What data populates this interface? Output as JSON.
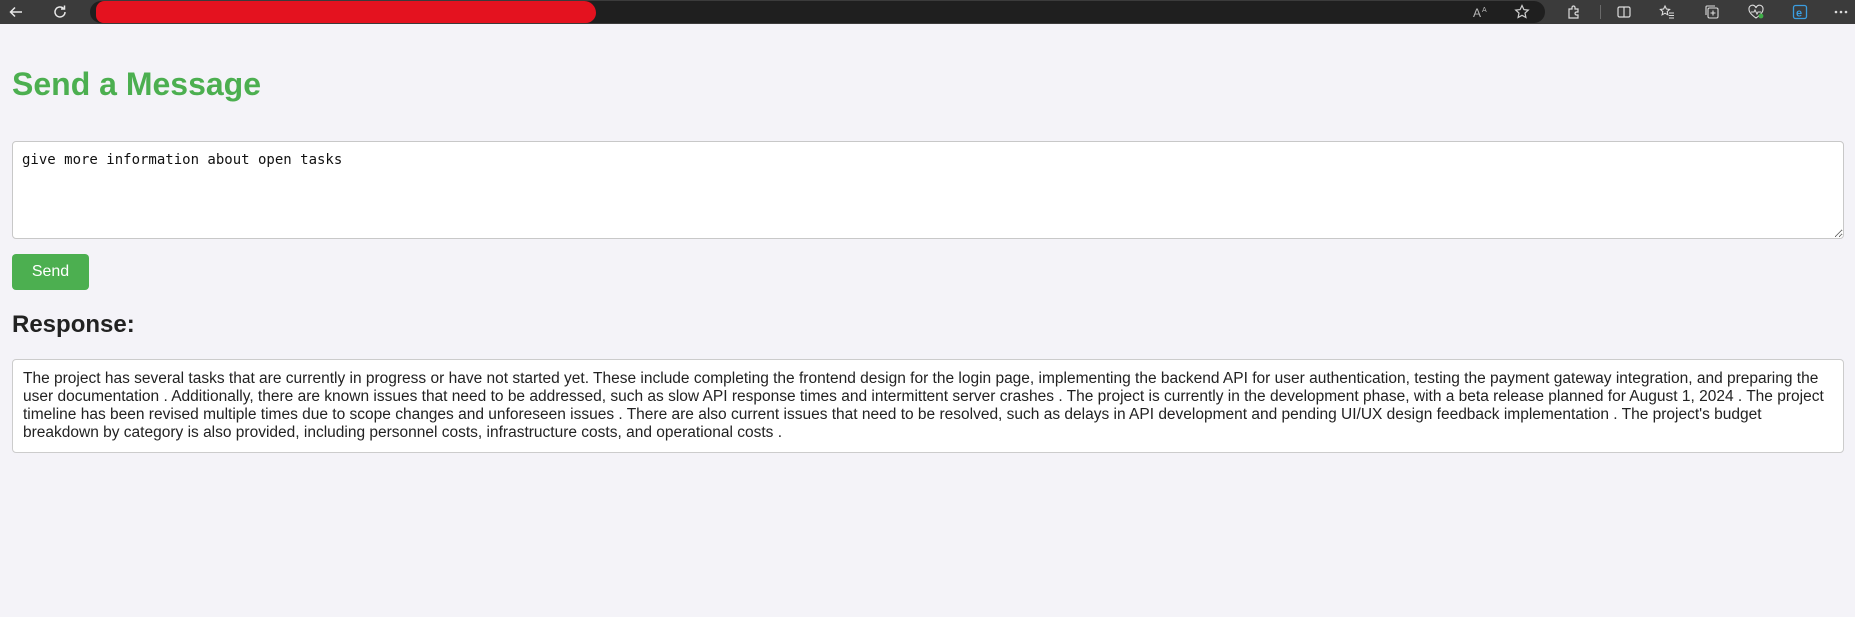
{
  "browser": {
    "toolbar_icons": [
      "back-icon",
      "refresh-icon",
      "read-aloud-icon",
      "favorite-star-icon",
      "extensions-icon",
      "split-screen-icon",
      "favorites-icon",
      "collections-icon",
      "browser-essentials-icon",
      "edge-icon",
      "more-icon"
    ]
  },
  "page": {
    "title": "Send a Message",
    "title_color": "#4caf50"
  },
  "form": {
    "message_value": "give more information about open tasks",
    "send_label": "Send"
  },
  "response": {
    "heading": "Response:",
    "text": "The project has several tasks that are currently in progress or have not started yet. These include completing the frontend design for the login page, implementing the backend API for user authentication, testing the payment gateway integration, and preparing the user documentation . Additionally, there are known issues that need to be addressed, such as slow API response times and intermittent server crashes . The project is currently in the development phase, with a beta release planned for August 1, 2024 . The project timeline has been revised multiple times due to scope changes and unforeseen issues . There are also current issues that need to be resolved, such as delays in API development and pending UI/UX design feedback implementation . The project's budget breakdown by category is also provided, including personnel costs, infrastructure costs, and operational costs ."
  }
}
